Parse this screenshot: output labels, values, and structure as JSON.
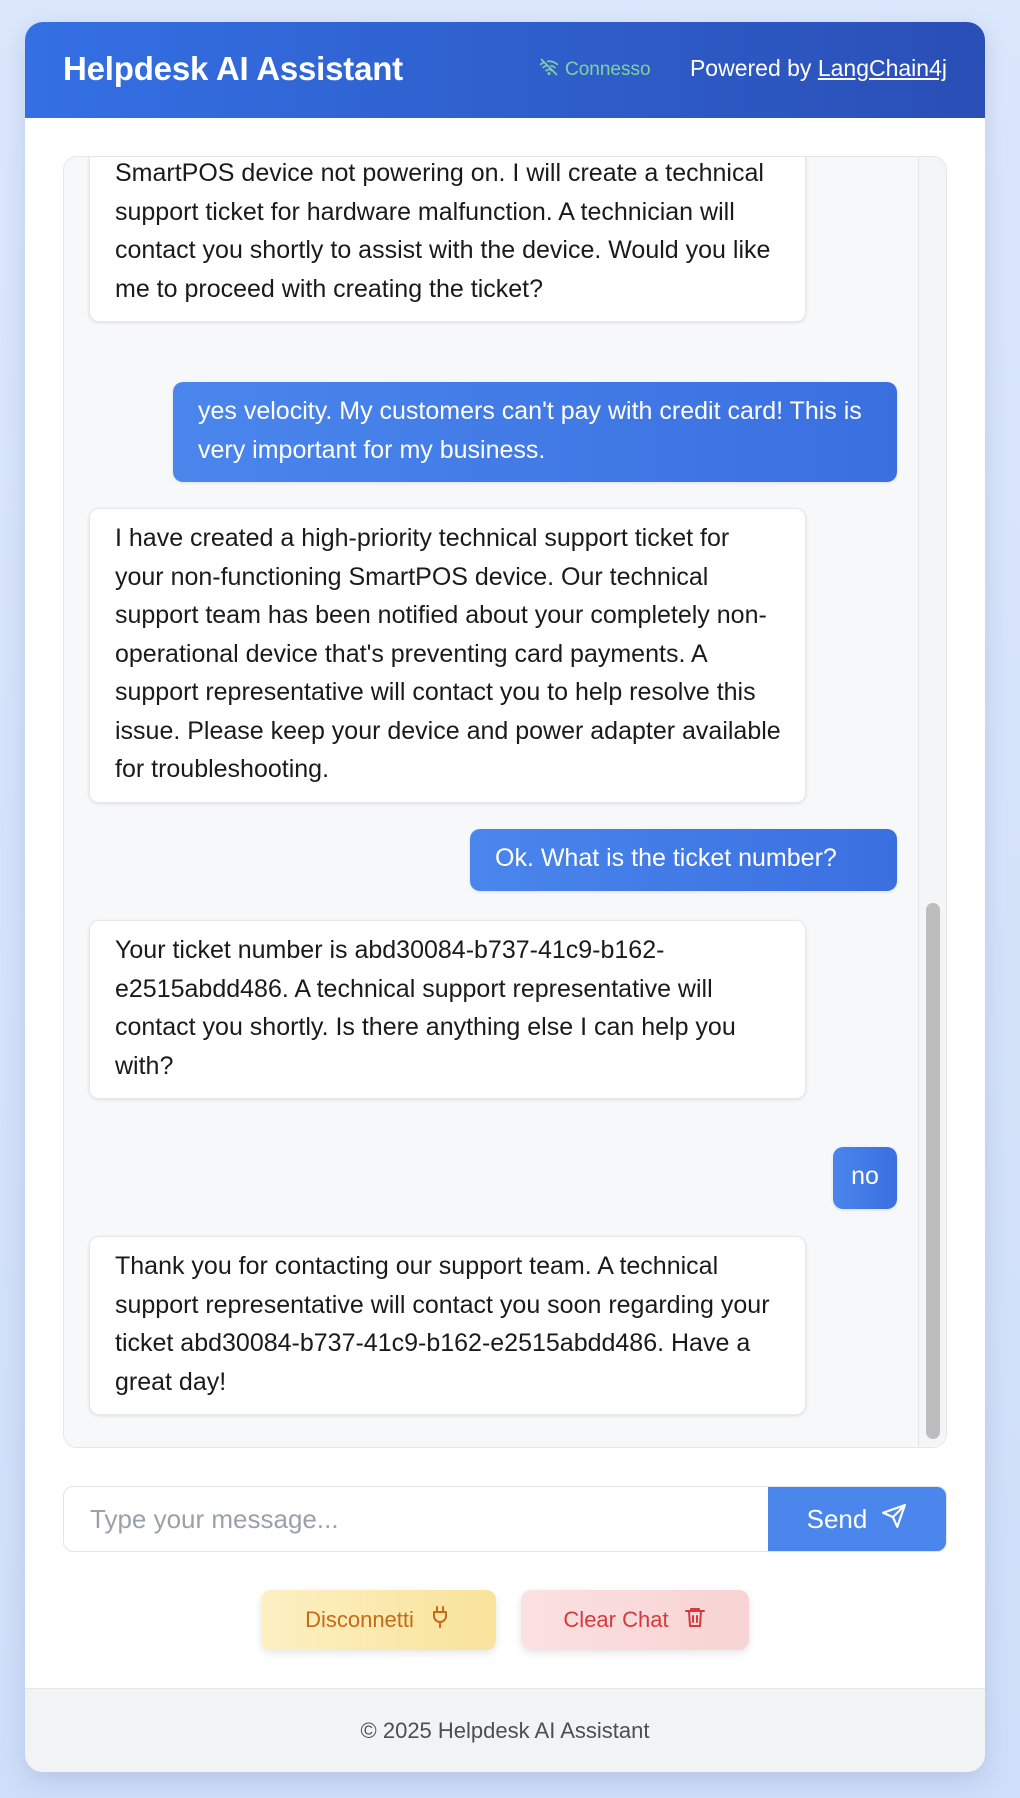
{
  "header": {
    "title": "Helpdesk AI Assistant",
    "status": "Connesso",
    "powered_prefix": "Powered by",
    "powered_link": "LangChain4j"
  },
  "chat": {
    "messages": [
      {
        "role": "assistant",
        "text": "SmartPOS device not powering on. I will create a technical support ticket for hardware malfunction. A technician will contact you shortly to assist with the device. Would you like me to proceed with creating the ticket?"
      },
      {
        "role": "user",
        "text": "yes velocity. My customers can't pay with credit card! This is very important for my business."
      },
      {
        "role": "assistant",
        "text": "I have created a high-priority technical support ticket for your non-functioning SmartPOS device. Our technical support team has been notified about your completely non-operational device that's preventing card payments. A support representative will contact you to help resolve this issue. Please keep your device and power adapter available for troubleshooting."
      },
      {
        "role": "user",
        "text": "Ok. What is the ticket number?"
      },
      {
        "role": "assistant",
        "text": "Your ticket number is abd30084-b737-41c9-b162-e2515abdd486. A technical support representative will contact you shortly. Is there anything else I can help you with?"
      },
      {
        "role": "user",
        "text": "no"
      },
      {
        "role": "assistant",
        "text": "Thank you for contacting our support team. A technical support representative will contact you soon regarding your ticket abd30084-b737-41c9-b162-e2515abdd486. Have a great day!"
      }
    ]
  },
  "composer": {
    "placeholder": "Type your message...",
    "send_label": "Send"
  },
  "actions": {
    "disconnect_label": "Disconnetti",
    "clear_label": "Clear Chat"
  },
  "footer": {
    "text": "© 2025 Helpdesk AI Assistant"
  },
  "icons": {
    "status": "wifi-off-icon",
    "send": "send-icon",
    "disconnect": "plug-icon",
    "clear": "trash-icon"
  },
  "colors": {
    "header_start": "#3470e4",
    "header_end": "#2a4fb6",
    "user_bubble": "#3a6fe0",
    "status_green": "#7fd39a",
    "disconnect_text": "#c56a17",
    "clear_text": "#d6393d"
  }
}
